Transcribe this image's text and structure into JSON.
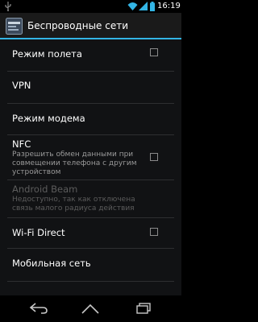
{
  "status_bar": {
    "time": "16:19",
    "icons": [
      "usb-icon",
      "wifi-icon",
      "signal-icon",
      "battery-icon"
    ]
  },
  "action_bar": {
    "title": "Беспроводные сети",
    "icon": "settings-app-icon",
    "accent_color": "#33b5e5"
  },
  "settings": [
    {
      "label": "Режим полета",
      "checkbox": true,
      "checked": false
    },
    {
      "label": "VPN"
    },
    {
      "label": "Режим модема"
    },
    {
      "label": "NFC",
      "summary": "Разрешить обмен данными при совмещении телефона с другим устройством",
      "checkbox": true,
      "checked": false
    },
    {
      "label": "Android Beam",
      "summary": "Недоступно, так как отключена связь малого радиуса действия",
      "disabled": true
    },
    {
      "label": "Wi-Fi Direct",
      "checkbox": true,
      "checked": false
    },
    {
      "label": "Мобильная сеть"
    }
  ],
  "nav_bar": {
    "buttons": [
      "back-icon",
      "home-icon",
      "recent-apps-icon"
    ]
  }
}
